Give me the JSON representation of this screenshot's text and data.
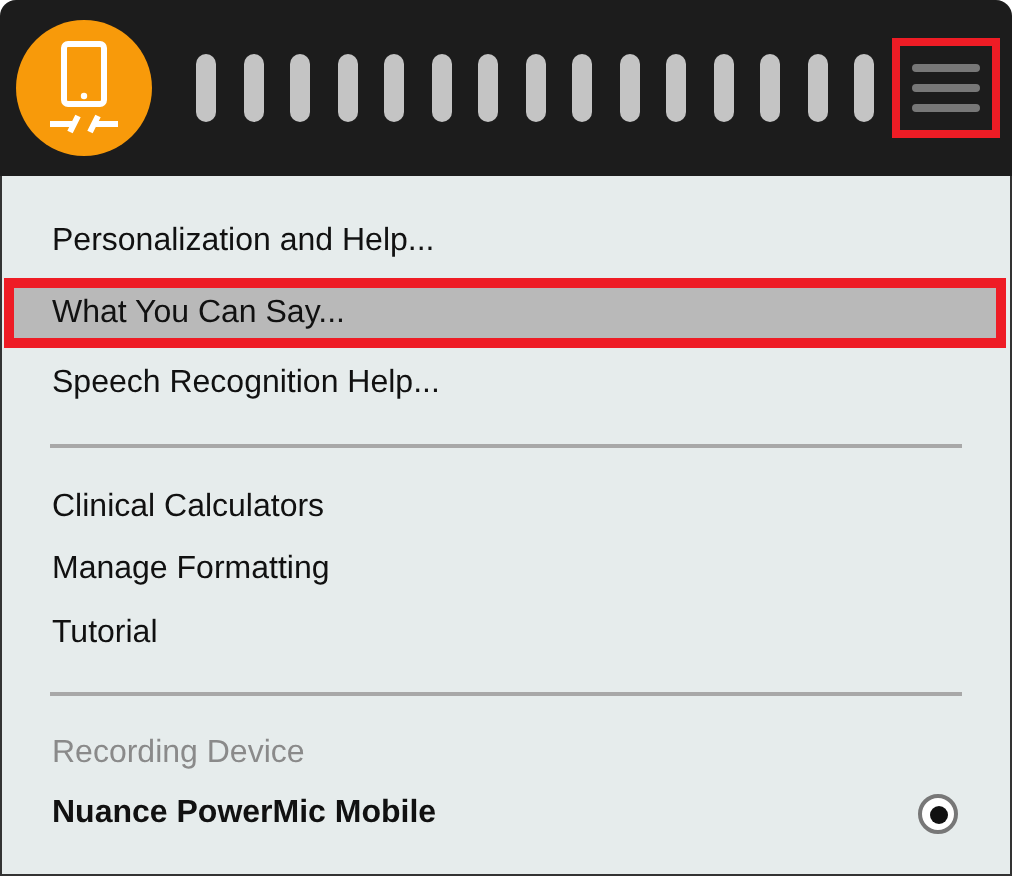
{
  "toolbar": {
    "menu_button": {
      "outlined": true
    }
  },
  "menu": {
    "groups": [
      {
        "items": [
          {
            "label": "Personalization and Help...",
            "selected": false,
            "outlined": false
          },
          {
            "label": "What You Can Say...",
            "selected": true,
            "outlined": true
          },
          {
            "label": "Speech Recognition Help...",
            "selected": false,
            "outlined": false
          }
        ]
      },
      {
        "items": [
          {
            "label": "Clinical Calculators",
            "selected": false,
            "outlined": false
          },
          {
            "label": "Manage Formatting",
            "selected": false,
            "outlined": false
          },
          {
            "label": "Tutorial",
            "selected": false,
            "outlined": false
          }
        ]
      }
    ],
    "recording": {
      "heading": "Recording Device",
      "devices": [
        {
          "label": "Nuance PowerMic Mobile",
          "selected": true
        }
      ]
    }
  }
}
